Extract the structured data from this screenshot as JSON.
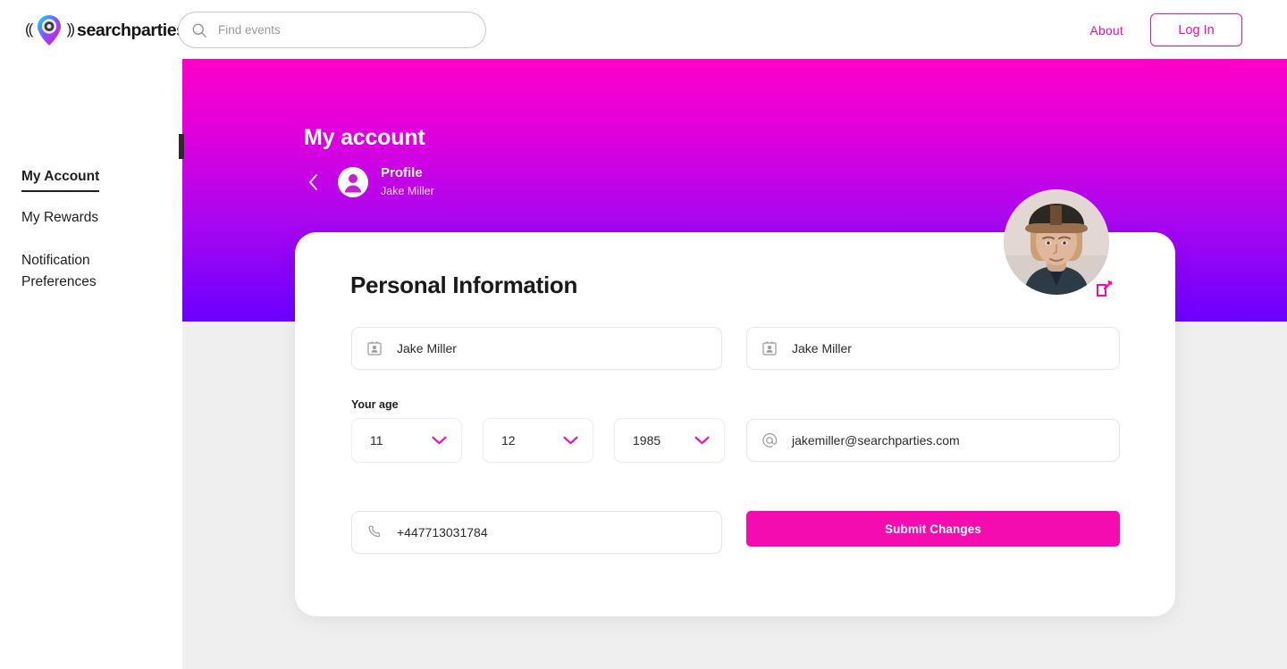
{
  "brand": {
    "name": "searchparties.",
    "logo_icon": "map-pin-gradient-icon"
  },
  "search": {
    "placeholder": "Find events",
    "value": "",
    "icon": "search-icon"
  },
  "nav": {
    "about_label": "About",
    "login_label": "Log In",
    "accent_color": "#F50CB0"
  },
  "sidebar": {
    "items": [
      {
        "label": "My Account",
        "active": true
      },
      {
        "label": "My Rewards",
        "active": false
      },
      {
        "label": "Notification Preferences",
        "active": false
      }
    ]
  },
  "hero": {
    "title": "My account",
    "back_icon": "chevron-left-icon",
    "avatar_icon": "user-circle-icon",
    "profile_title": "Profile",
    "profile_name": "Jake Miller",
    "gradient_from": "#FF00C8",
    "gradient_to": "#6A00FF"
  },
  "photo": {
    "alt": "profile-photo",
    "edit_icon": "edit-pencil-icon"
  },
  "card": {
    "title": "Personal Information",
    "fields": {
      "first_name": {
        "icon": "contact-card-icon",
        "value": "Jake Miller"
      },
      "last_name": {
        "icon": "contact-card-icon",
        "value": "Jake Miller"
      },
      "email": {
        "icon": "at-sign-icon",
        "value": "jakemiller@searchparties.com"
      },
      "phone": {
        "icon": "phone-icon",
        "value": "+447713031784"
      }
    },
    "age": {
      "label": "Your age",
      "day": "11",
      "month": "12",
      "year": "1985",
      "chevron_icon": "chevron-down-icon"
    },
    "submit_label": "Submit Changes"
  }
}
